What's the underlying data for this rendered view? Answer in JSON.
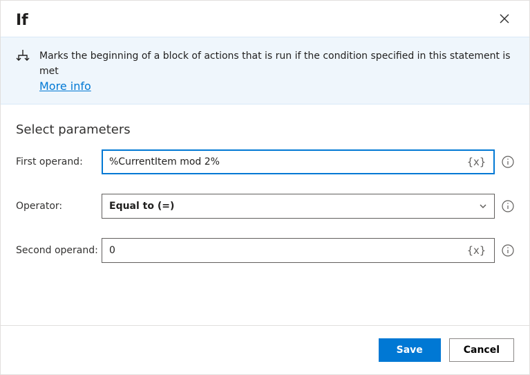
{
  "dialog": {
    "title": "If",
    "banner": {
      "text": "Marks the beginning of a block of actions that is run if the condition specified in this statement is met",
      "more_info": "More info"
    },
    "section_title": "Select parameters",
    "fields": {
      "first_operand": {
        "label": "First operand:",
        "value": "%CurrentItem mod 2%",
        "token": "{x}"
      },
      "operator": {
        "label": "Operator:",
        "value": "Equal to (=)"
      },
      "second_operand": {
        "label": "Second operand:",
        "value": "0",
        "token": "{x}"
      }
    },
    "buttons": {
      "save": "Save",
      "cancel": "Cancel"
    }
  }
}
